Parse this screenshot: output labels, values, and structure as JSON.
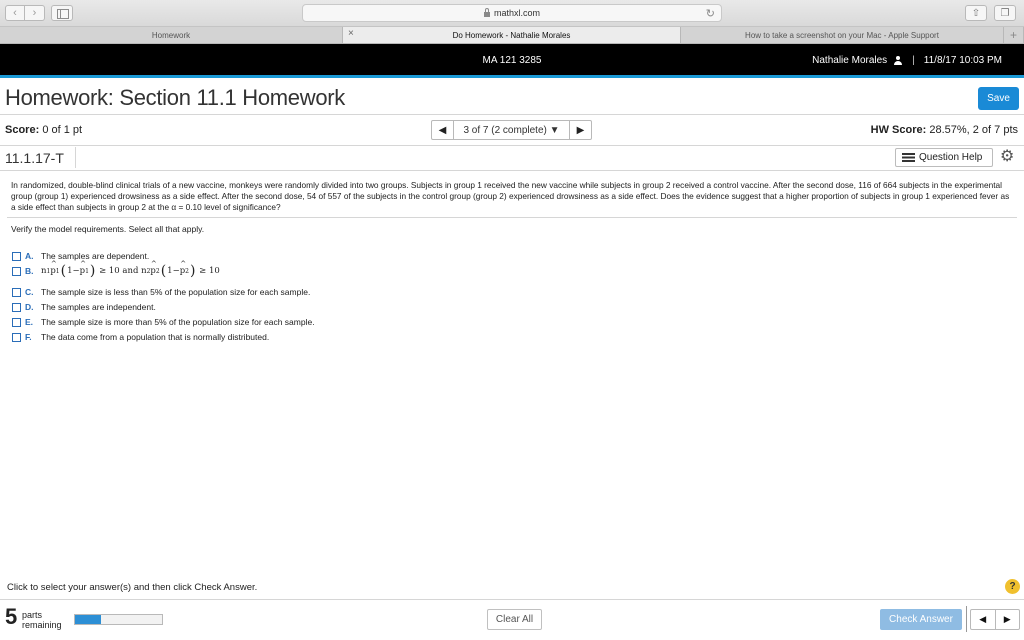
{
  "browser": {
    "url": "mathxl.com",
    "tabs": [
      {
        "label": "Homework",
        "active": false
      },
      {
        "label": "Do Homework - Nathalie Morales",
        "active": true
      },
      {
        "label": "How to take a screenshot on your Mac - Apple Support",
        "active": false
      }
    ]
  },
  "course_bar": {
    "course": "MA 121 3285",
    "user": "Nathalie Morales",
    "datetime": "11/8/17 10:03 PM"
  },
  "homework": {
    "title": "Homework: Section 11.1 Homework",
    "save_label": "Save",
    "score_label": "Score:",
    "score_value": "0 of 1 pt",
    "question_nav": "3 of 7 (2 complete)",
    "hw_score_label": "HW Score:",
    "hw_score_value": "28.57%, 2 of 7 pts",
    "question_id": "11.1.17-T",
    "question_help_label": "Question Help"
  },
  "question": {
    "text": "In randomized, double-blind clinical trials of a new vaccine, monkeys were randomly divided into two groups. Subjects in group 1 received the new vaccine while subjects in group 2 received a control vaccine. After the second dose, 116 of 664 subjects in the experimental group (group 1) experienced drowsiness as a side effect. After the second dose, 54 of 557 of the subjects in the control group (group 2) experienced drowsiness as a side effect. Does the evidence suggest that a higher proportion of subjects in group 1 experienced fever as a side effect than subjects in group 2 at the α = 0.10 level of significance?",
    "instructions": "Verify the model requirements. Select all that apply.",
    "options": [
      {
        "letter": "A.",
        "text": "The samples are dependent."
      },
      {
        "letter": "B.",
        "text": ""
      },
      {
        "letter": "C.",
        "text": "The sample size is less than 5% of the population size for each sample."
      },
      {
        "letter": "D.",
        "text": "The samples are independent."
      },
      {
        "letter": "E.",
        "text": "The sample size is more than 5% of the population size for each sample."
      },
      {
        "letter": "F.",
        "text": "The data come from a population that is normally distributed."
      }
    ],
    "option_b_math": {
      "n1": "n",
      "sub1": "1",
      "p1": "p",
      "sub1b": "1",
      "one": "1",
      "minus": "−",
      "cond1": "≥ 10",
      "and": "and",
      "n2": "n",
      "sub2": "2",
      "p2": "p",
      "sub2b": "2",
      "cond2": "≥ 10"
    }
  },
  "footer": {
    "hint": "Click to select your answer(s) and then click Check Answer.",
    "help_icon": "?",
    "parts_count": "5",
    "parts_label_1": "parts",
    "parts_label_2": "remaining",
    "progress_fraction": 0.3,
    "clear_label": "Clear All",
    "check_label": "Check Answer"
  },
  "colors": {
    "accent": "#1a8ad6",
    "link_blue": "#2a6db8",
    "course_bar": "#000000",
    "check_disabled": "#8fbce3",
    "help_yellow": "#f0c02e"
  }
}
